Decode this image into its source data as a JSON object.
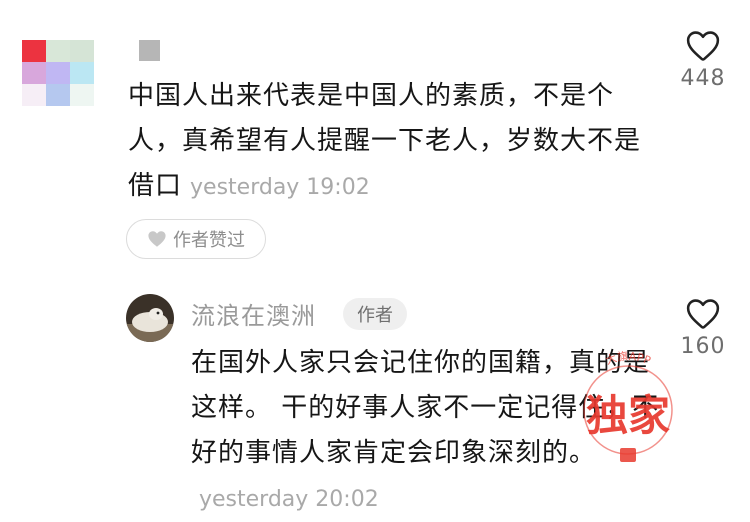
{
  "comment": {
    "text": "中国人出来代表是中国人的素质，不是个人，真希望有人提醒一下老人，岁数大不是借口",
    "timestamp": "yesterday 19:02",
    "likes": "448",
    "author_liked_label": "作者赞过"
  },
  "reply": {
    "username": "流浪在澳洲",
    "author_badge": "作者",
    "text": "在国外人家只会记住你的国籍，真的是这样。 干的好事人家不一定记得住，不好的事情人家肯定会印象深刻的。",
    "timestamp": "yesterday 20:02",
    "likes": "160"
  },
  "watermark": {
    "main": "独家",
    "arc_text": "大旗APP"
  },
  "icons": [
    "heart-outline-icon",
    "heart-filled-icon"
  ],
  "colors": {
    "text": "#161616",
    "muted": "#a9a9a9",
    "watermark": "#e8392e"
  }
}
